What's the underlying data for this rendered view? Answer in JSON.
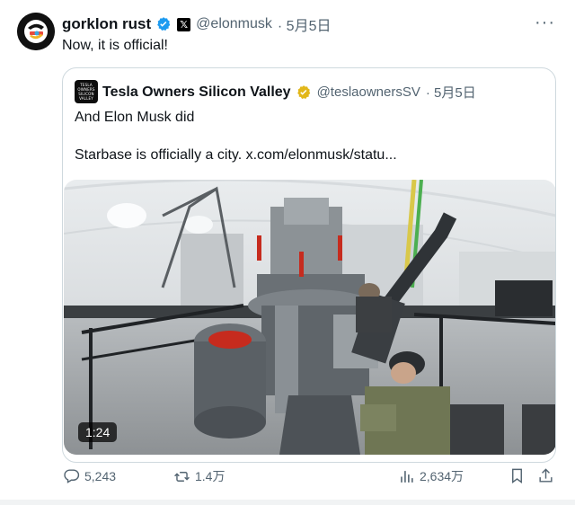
{
  "author": {
    "name": "gorklon rust",
    "handle": "@elonmusk",
    "date": "· 5月5日",
    "text": "Now, it is official!",
    "avatar_icon": "gorklon-logo"
  },
  "quoted": {
    "name": "Tesla Owners Silicon Valley",
    "handle": "@teslaownersSV",
    "date": "· 5月5日",
    "avatar_lines": [
      "TESLA",
      "OWNERS",
      "SILICON",
      "VALLEY"
    ],
    "line1": "And Elon Musk did",
    "line2": "Starbase is officially a city.  x.com/elonmusk/statu...",
    "video_duration": "1:24"
  },
  "actions": {
    "replies": "5,243",
    "reposts": "1.4万",
    "views": "2,634万"
  },
  "colors": {
    "verified_blue": "#1d9bf0",
    "verified_gold": "#e2b719",
    "muted": "#536471"
  }
}
